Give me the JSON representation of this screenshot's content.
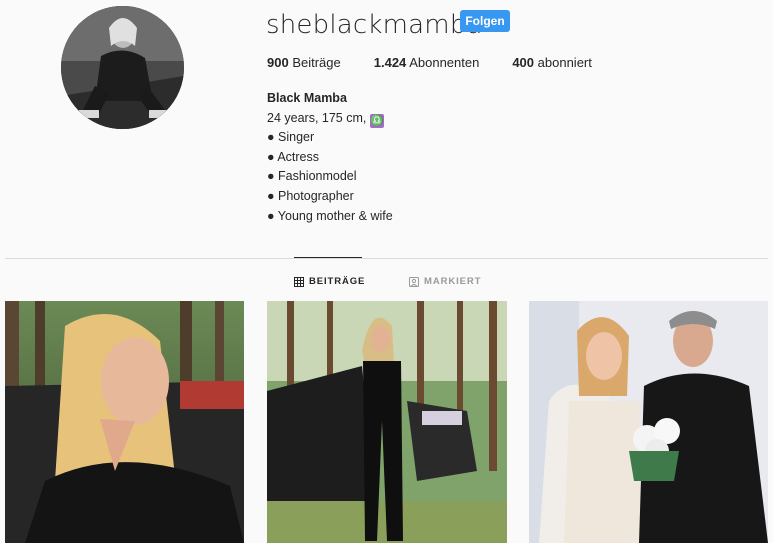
{
  "profile": {
    "username": "sheblackmamba",
    "follow_label": "Folgen",
    "accent_color": "#3897f0"
  },
  "stats": [
    {
      "count": "900",
      "label": "Beiträge"
    },
    {
      "count": "1.424",
      "label": "Abonnenten"
    },
    {
      "count": "400",
      "label": "abonniert"
    }
  ],
  "bio": {
    "name": "Black Mamba",
    "details": "24 years, 175 cm,",
    "zodiac_icon": "libra-icon",
    "items": [
      "● Singer",
      "● Actress",
      "● Fashionmodel",
      "● Photographer",
      "● Young mother & wife"
    ]
  },
  "tabs": [
    {
      "label": "BEITRÄGE",
      "icon": "grid-icon",
      "active": true
    },
    {
      "label": "MARKIERT",
      "icon": "tag-icon",
      "active": false
    }
  ]
}
